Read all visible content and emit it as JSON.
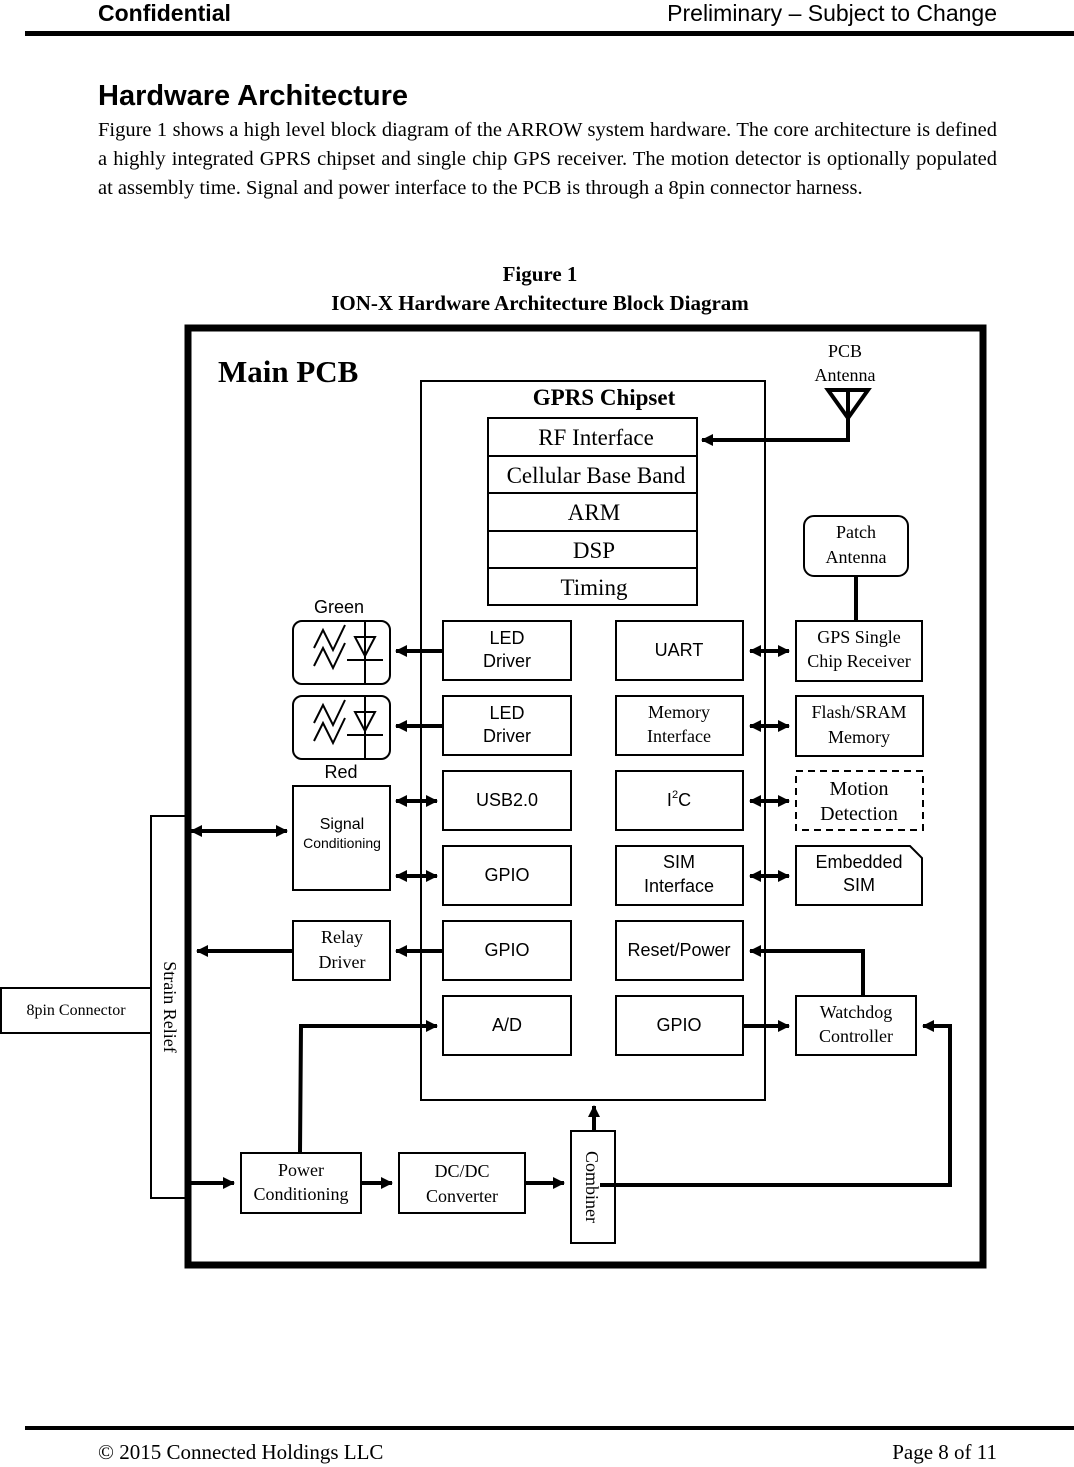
{
  "header": {
    "left": "Confidential",
    "right": "Preliminary – Subject to Change"
  },
  "section": {
    "title": "Hardware Architecture",
    "paragraph": "Figure 1 shows a high level block diagram of the ARROW system hardware.  The core architecture is defined a highly integrated GPRS chipset and single chip GPS receiver.  The motion detector is optionally populated at assembly time.   Signal and power interface to the PCB is through a 8pin connector harness."
  },
  "figure": {
    "number": "Figure 1",
    "caption": "ION-X Hardware Architecture Block Diagram",
    "main_pcb_label": "Main PCB",
    "gprs_chipset": {
      "title": "GPRS Chipset",
      "stack": [
        "RF Interface",
        "Cellular Base Band",
        "ARM",
        "DSP",
        "Timing"
      ],
      "left_column": [
        {
          "l1": "LED",
          "l2": "Driver"
        },
        {
          "l1": "LED",
          "l2": "Driver"
        },
        {
          "l1": "USB2.0",
          "l2": ""
        },
        {
          "l1": "GPIO",
          "l2": ""
        },
        {
          "l1": "GPIO",
          "l2": ""
        },
        {
          "l1": "A/D",
          "l2": ""
        }
      ],
      "right_column": [
        {
          "l1": "UART",
          "l2": ""
        },
        {
          "l1": "Memory",
          "l2": "Interface"
        },
        {
          "l1": "I",
          "sup": "2",
          "l1b": "C",
          "l2": ""
        },
        {
          "l1": "SIM",
          "l2": "Interface"
        },
        {
          "l1": "Reset/Power",
          "l2": ""
        },
        {
          "l1": "GPIO",
          "l2": ""
        }
      ]
    },
    "pcb_antenna": {
      "l1": "PCB",
      "l2": "Antenna"
    },
    "patch_antenna": {
      "l1": "Patch",
      "l2": "Antenna"
    },
    "peripherals": [
      {
        "l1": "GPS Single",
        "l2": "Chip Receiver",
        "style": "solid"
      },
      {
        "l1": "Flash/SRAM",
        "l2": "Memory",
        "style": "solid"
      },
      {
        "l1": "Motion",
        "l2": "Detection",
        "style": "dashed"
      },
      {
        "l1": "Embedded",
        "l2": "SIM",
        "style": "sim-card"
      }
    ],
    "leds": {
      "top_label": "Green",
      "bottom_label": "Red"
    },
    "signal_conditioning": {
      "l1": "Signal",
      "l2": "Conditioning"
    },
    "relay_driver": {
      "l1": "Relay",
      "l2": "Driver"
    },
    "watchdog": {
      "l1": "Watchdog",
      "l2": "Controller"
    },
    "power_conditioning": {
      "l1": "Power",
      "l2": "Conditioning"
    },
    "dcdc": {
      "l1": "DC/DC",
      "l2": "Converter"
    },
    "combiner": "Combiner",
    "strain_relief": "Strain Relief",
    "connector": "8pin Connector"
  },
  "footer": {
    "left": "© 2015 Connected Holdings LLC",
    "right": "Page 8 of 11"
  }
}
